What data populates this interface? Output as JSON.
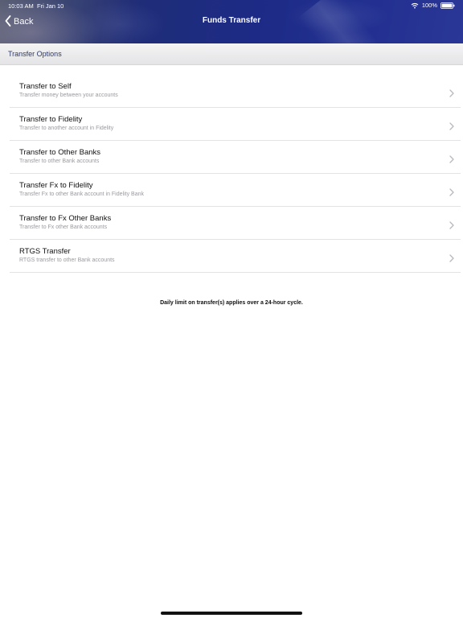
{
  "status_bar": {
    "time": "10:03 AM",
    "date": "Fri Jan 10",
    "battery": "100%"
  },
  "nav": {
    "back_label": "Back",
    "title": "Funds Transfer"
  },
  "section": {
    "title": "Transfer Options"
  },
  "transfer_options": [
    {
      "title": "Transfer to Self",
      "subtitle": "Transfer money between your accounts"
    },
    {
      "title": "Transfer to Fidelity",
      "subtitle": "Transfer to another account in Fidelity"
    },
    {
      "title": "Transfer to Other Banks",
      "subtitle": "Transfer to other Bank accounts"
    },
    {
      "title": "Transfer Fx to Fidelity",
      "subtitle": "Transfer Fx to other Bank account in Fidelity Bank"
    },
    {
      "title": "Transfer to Fx Other Banks",
      "subtitle": "Transfer to Fx other Bank accounts"
    },
    {
      "title": "RTGS Transfer",
      "subtitle": "RTGS transfer to other Bank accounts"
    }
  ],
  "footer_note": "Daily limit on transfer(s) applies over a 24-hour cycle.",
  "icons": {
    "back": "chevron-left-icon",
    "row_arrow": "chevron-right-icon",
    "wifi": "wifi-icon",
    "battery": "battery-icon"
  },
  "colors": {
    "header_blue": "#1f2c86",
    "section_text": "#2d3a6a",
    "subtitle_gray": "#9a9aa0"
  }
}
